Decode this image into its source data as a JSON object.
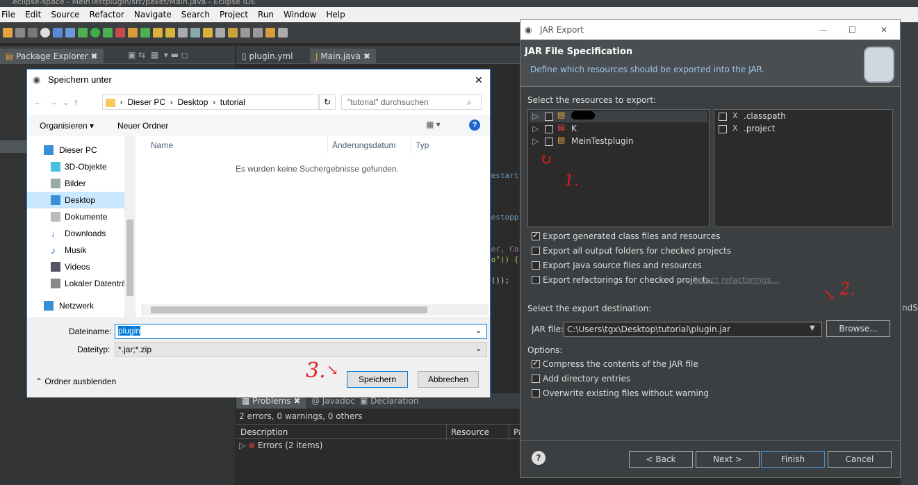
{
  "eclipse": {
    "window_title": "eclipse-space - MeinTestplugin/src/paket/Main.java - Eclipse IDE",
    "menu": [
      "File",
      "Edit",
      "Source",
      "Refactor",
      "Navigate",
      "Search",
      "Project",
      "Run",
      "Window",
      "Help"
    ],
    "left_tab": "Package Explorer",
    "editor_tabs": [
      "plugin.yml",
      "Main.java"
    ],
    "code_fragments": [
      "gestart",
      "gestopp",
      "der, Co",
      "io\")) {",
      "e());"
    ],
    "bottom_tabs": [
      "Problems",
      "Javadoc",
      "Declaration"
    ],
    "problems_summary": "2 errors, 0 warnings, 0 others",
    "problems_columns": [
      "Description",
      "Resource",
      "Pa"
    ],
    "problems_row": "Errors (2 items)",
    "right_fragment": "ndSe"
  },
  "jar": {
    "title": "JAR Export",
    "heading": "JAR File Specification",
    "subheading": "Define which resources should be exported into the JAR.",
    "select_label": "Select the resources to export:",
    "tree": [
      {
        "label": ""
      },
      {
        "label": "K"
      },
      {
        "label": "MeinTestplugin"
      }
    ],
    "files": [
      ".classpath",
      ".project"
    ],
    "options1": [
      {
        "label": "Export generated class files and resources",
        "checked": true
      },
      {
        "label": "Export all output folders for checked projects",
        "checked": false
      },
      {
        "label": "Export Java source files and resources",
        "checked": false
      },
      {
        "label": "Export refactorings for checked projects.",
        "checked": false
      }
    ],
    "select_refactorings": "Select refactorings...",
    "dest_label": "Select the export destination:",
    "jarfile_label": "JAR file:",
    "jarfile_value": "C:\\Users\\tgx\\Desktop\\tutorial\\plugin.jar",
    "browse": "Browse...",
    "options_label": "Options:",
    "options2": [
      {
        "label": "Compress the contents of the JAR file",
        "checked": true
      },
      {
        "label": "Add directory entries",
        "checked": false
      },
      {
        "label": "Overwrite existing files without warning",
        "checked": false
      }
    ],
    "buttons": {
      "back": "< Back",
      "next": "Next >",
      "finish": "Finish",
      "cancel": "Cancel"
    },
    "help": "?"
  },
  "save": {
    "title": "Speichern unter",
    "breadcrumb": [
      "Dieser PC",
      "Desktop",
      "tutorial"
    ],
    "search_placeholder": "\"tutorial\" durchsuchen",
    "organize": "Organisieren",
    "new_folder": "Neuer Ordner",
    "nav": [
      "Dieser PC",
      "3D-Objekte",
      "Bilder",
      "Desktop",
      "Dokumente",
      "Downloads",
      "Musik",
      "Videos",
      "Lokaler Datenträ",
      "Netzwerk"
    ],
    "columns": [
      "Name",
      "Änderungsdatum",
      "Typ"
    ],
    "empty_msg": "Es wurden keine Suchergebnisse gefunden.",
    "filename_label": "Dateiname:",
    "filename_value": "plugin",
    "filetype_label": "Dateityp:",
    "filetype_value": "*.jar;*.zip",
    "hide_folders": "Ordner ausblenden",
    "save_btn": "Speichern",
    "cancel_btn": "Abbrechen"
  },
  "annotations": {
    "a1": "1.",
    "a2": "2.",
    "a3": "3."
  }
}
